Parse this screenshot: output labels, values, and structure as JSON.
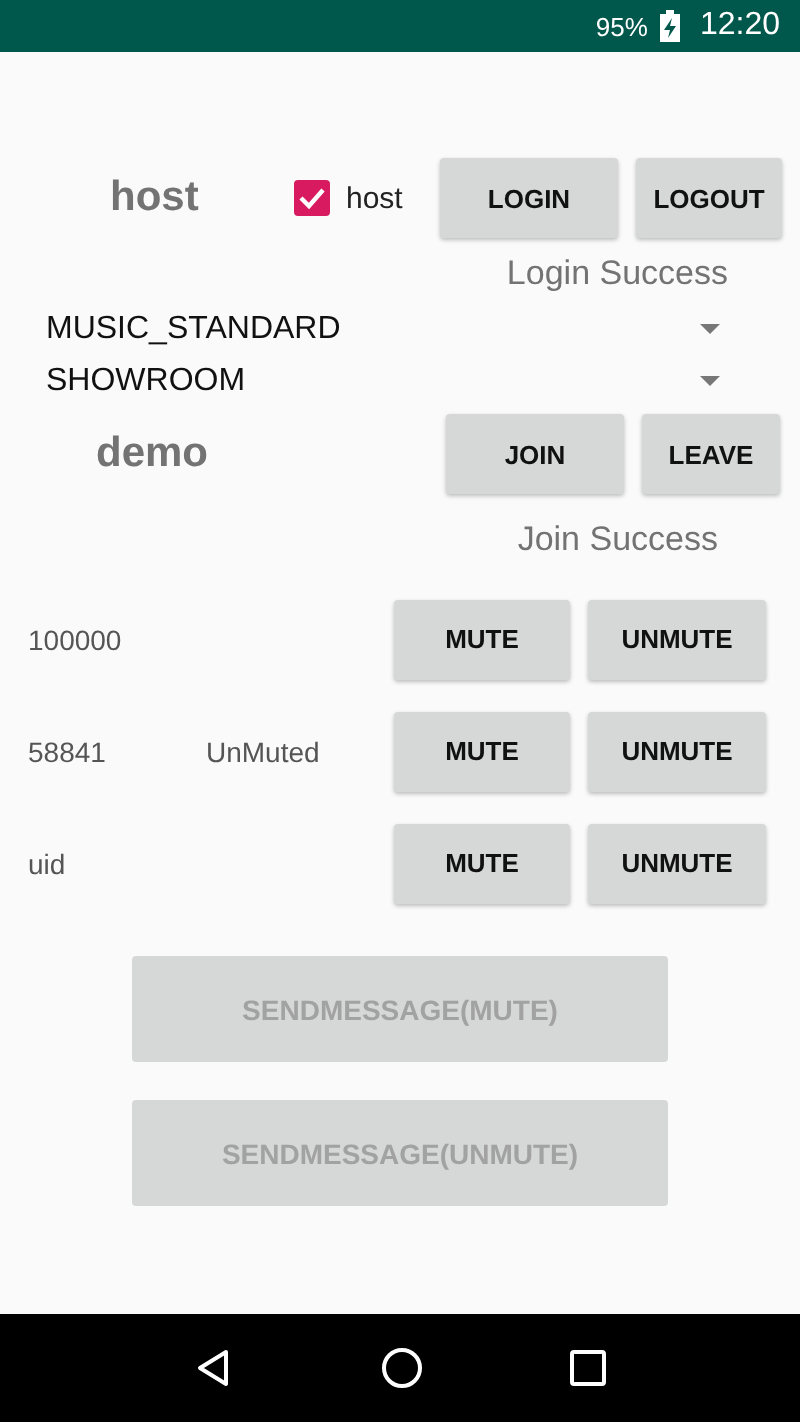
{
  "status_bar": {
    "battery": "95%",
    "time": "12:20"
  },
  "login": {
    "title": "host",
    "checkbox": {
      "label": "host",
      "checked": true
    },
    "buttons": [
      "LOGIN",
      "LOGOUT"
    ],
    "status": "Login Success"
  },
  "spinners": [
    {
      "value": "MUSIC_STANDARD"
    },
    {
      "value": "SHOWROOM"
    }
  ],
  "channel": {
    "name": "demo",
    "buttons": [
      "JOIN",
      "LEAVE"
    ],
    "status": "Join Success"
  },
  "users": [
    {
      "uid": "100000",
      "buttons": [
        "MUTE",
        "UNMUTE"
      ]
    },
    {
      "uid": "58841",
      "status": "UnMuted",
      "buttons": [
        "MUTE",
        "UNMUTE"
      ]
    },
    {
      "uid": "uid",
      "buttons": [
        "MUTE",
        "UNMUTE"
      ]
    }
  ],
  "send_buttons": [
    {
      "label": "SENDMESSAGE(MUTE)",
      "disabled": true
    },
    {
      "label": "SENDMESSAGE(UNMUTE)",
      "disabled": true
    }
  ]
}
